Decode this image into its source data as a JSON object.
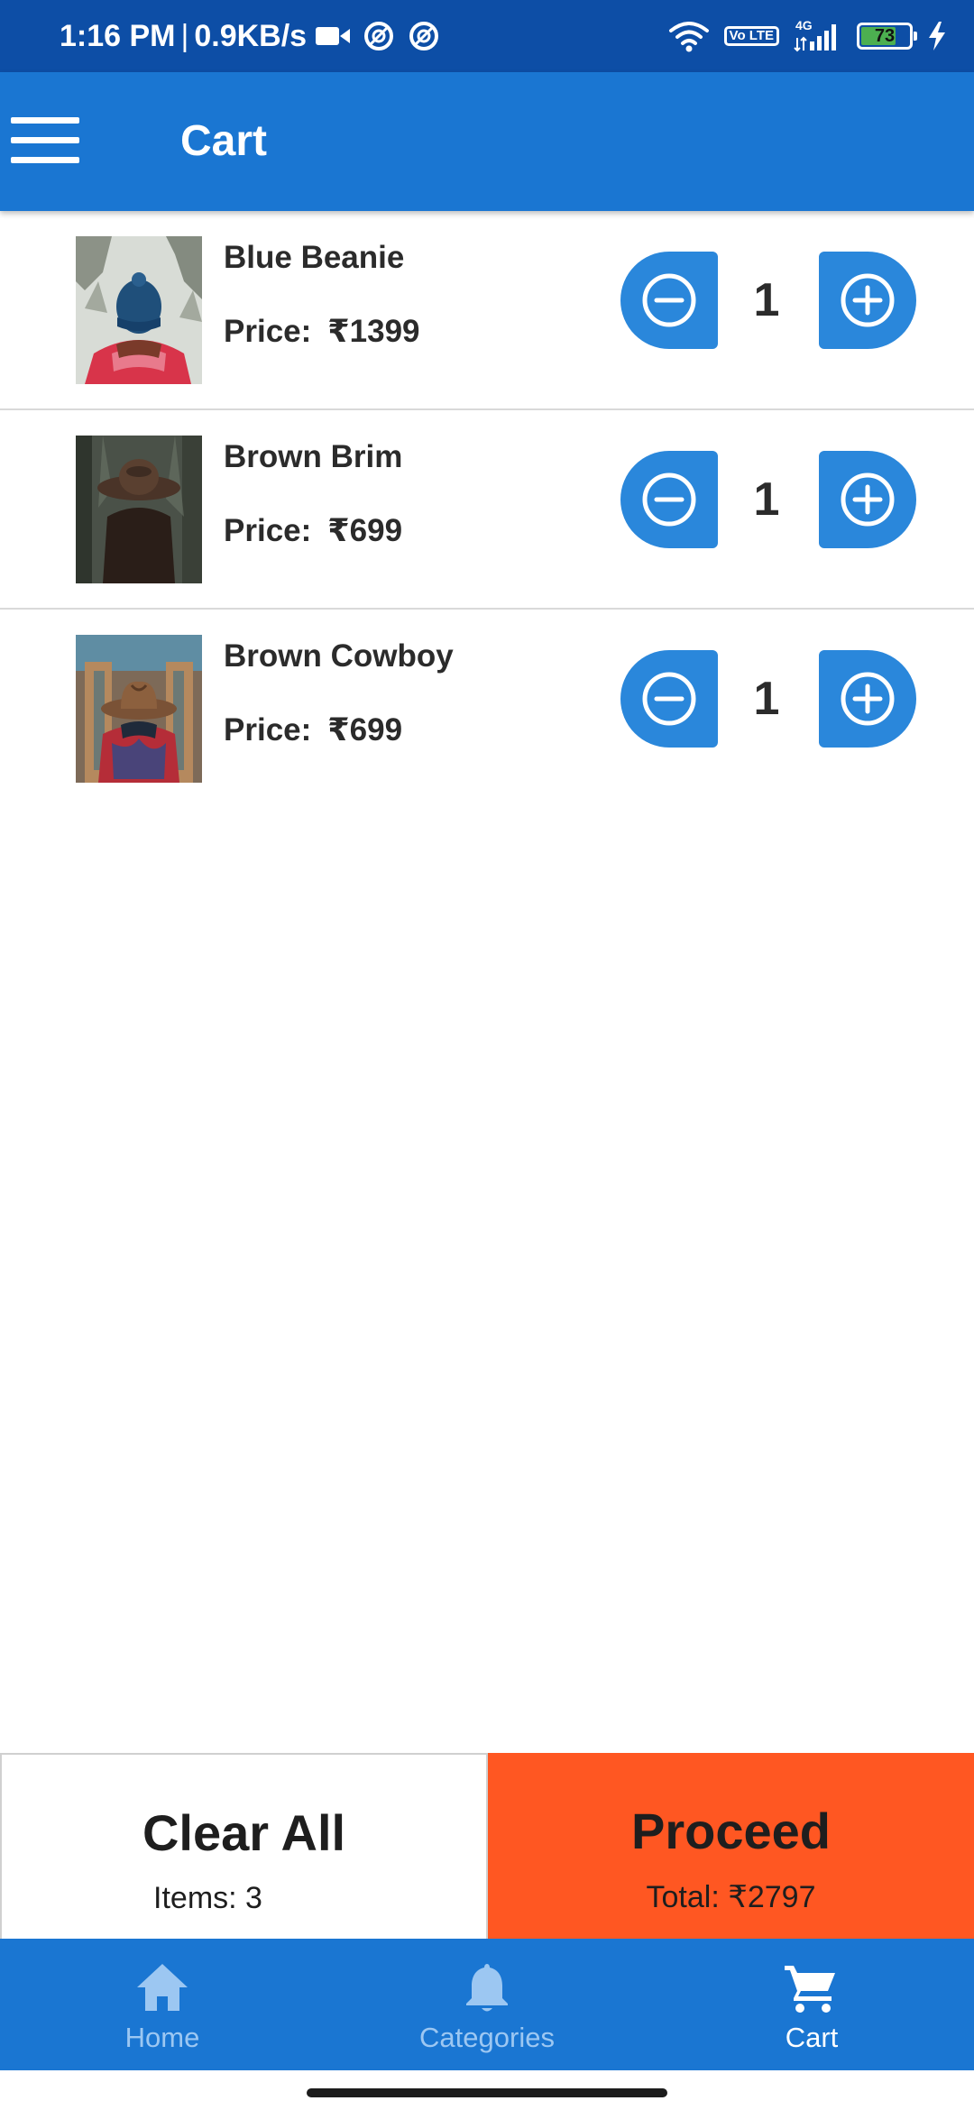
{
  "status_bar": {
    "time": "1:16 PM",
    "separator": "|",
    "speed": "0.9KB/s",
    "network_type": "4G",
    "volte_label": "Vo LTE",
    "battery_level": "73",
    "colors": {
      "background": "#0d4ea6",
      "battery_fill": "#4caf50"
    },
    "icons": [
      "video-camera-icon",
      "app-notification-icon",
      "app-notification-icon",
      "wifi-icon",
      "volte-icon",
      "signal-icon",
      "battery-icon",
      "charging-icon"
    ]
  },
  "app_bar": {
    "title": "Cart",
    "menu_icon": "hamburger-menu-icon",
    "color": "#1a76d2"
  },
  "cart": {
    "price_label": "Price:",
    "items": [
      {
        "name": "Blue Beanie",
        "price": "₹1399",
        "quantity": "1",
        "image": "person-in-blue-beanie-snow"
      },
      {
        "name": "Brown Brim",
        "price": "₹699",
        "quantity": "1",
        "image": "person-in-brown-brim-hat-forest"
      },
      {
        "name": "Brown Cowboy",
        "price": "₹699",
        "quantity": "1",
        "image": "person-in-brown-cowboy-hat"
      }
    ],
    "minus_icon": "minus-circle-icon",
    "plus_icon": "plus-circle-icon",
    "button_color": "#2a87db"
  },
  "actions": {
    "clear": {
      "label": "Clear All",
      "sub": "Items: 3"
    },
    "proceed": {
      "label": "Proceed",
      "sub": "Total: ₹2797",
      "color": "#ff5722"
    }
  },
  "bottom_nav": {
    "items": [
      {
        "label": "Home",
        "icon": "home-icon",
        "active": false
      },
      {
        "label": "Categories",
        "icon": "bell-icon",
        "active": false
      },
      {
        "label": "Cart",
        "icon": "cart-icon",
        "active": true
      }
    ],
    "active_color": "#ffffff",
    "inactive_color": "#9cc7f2"
  }
}
